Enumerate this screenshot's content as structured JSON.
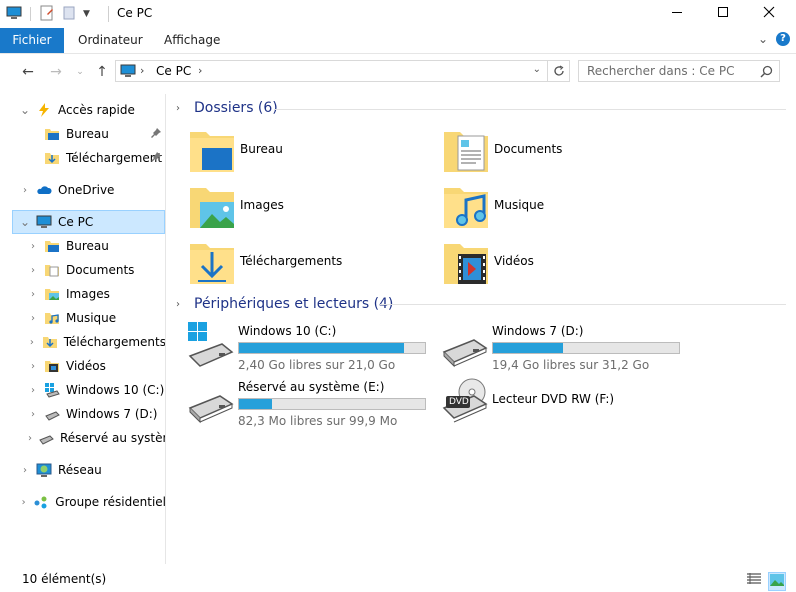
{
  "window": {
    "title": "Ce PC"
  },
  "ribbon": {
    "tabs": [
      "Fichier",
      "Ordinateur",
      "Affichage"
    ]
  },
  "address": {
    "location": "Ce PC"
  },
  "search": {
    "placeholder": "Rechercher dans : Ce PC"
  },
  "nav": {
    "quick_access": "Accès rapide",
    "quick_items": [
      "Bureau",
      "Téléchargement"
    ],
    "onedrive": "OneDrive",
    "this_pc": "Ce PC",
    "pc_items": [
      "Bureau",
      "Documents",
      "Images",
      "Musique",
      "Téléchargements",
      "Vidéos",
      "Windows 10 (C:)",
      "Windows 7 (D:)",
      "Réservé au système"
    ],
    "network": "Réseau",
    "homegroup": "Groupe résidentiel"
  },
  "content": {
    "folders_header": "Dossiers (6)",
    "folders": [
      "Bureau",
      "Documents",
      "Images",
      "Musique",
      "Téléchargements",
      "Vidéos"
    ],
    "devices_header": "Périphériques et lecteurs (4)",
    "drives": [
      {
        "name": "Windows 10 (C:)",
        "free": "2,40 Go libres sur 21,0 Go",
        "used_fraction": 0.886
      },
      {
        "name": "Windows 7 (D:)",
        "free": "19,4 Go libres sur 31,2 Go",
        "used_fraction": 0.378
      },
      {
        "name": "Réservé au système (E:)",
        "free": "82,3 Mo libres sur 99,9 Mo",
        "used_fraction": 0.176
      }
    ],
    "dvd": {
      "name": "Lecteur DVD RW (F:)",
      "badge": "DVD"
    }
  },
  "status": {
    "count": "10 élément(s)"
  },
  "colors": {
    "accent": "#1979ca",
    "selection": "#cce8ff",
    "header": "#1e3287",
    "bar": "#26a0da",
    "folder": "#f8d775"
  }
}
